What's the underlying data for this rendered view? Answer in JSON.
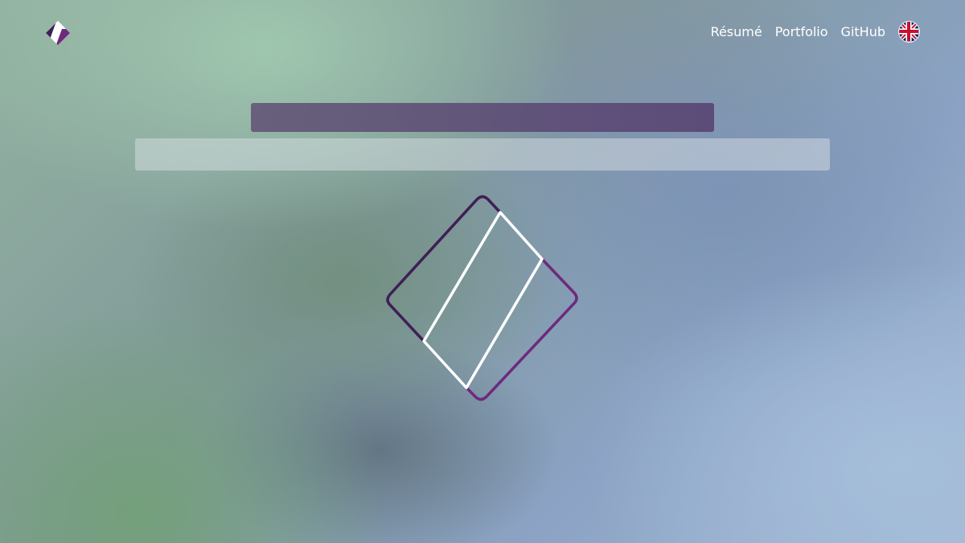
{
  "nav": {
    "items": [
      {
        "label": "Résumé"
      },
      {
        "label": "Portfolio"
      },
      {
        "label": "GitHub"
      }
    ],
    "language": {
      "icon": "uk-flag-icon"
    }
  },
  "icons": {
    "logo": "diamond-logo-icon",
    "hero": "diamond-logo-icon"
  },
  "colors": {
    "brand_dark": "#3f1f55",
    "brand_purple": "#6e2a7e",
    "title_bar": "#5f4f7a",
    "nav_text": "#ffffff"
  }
}
